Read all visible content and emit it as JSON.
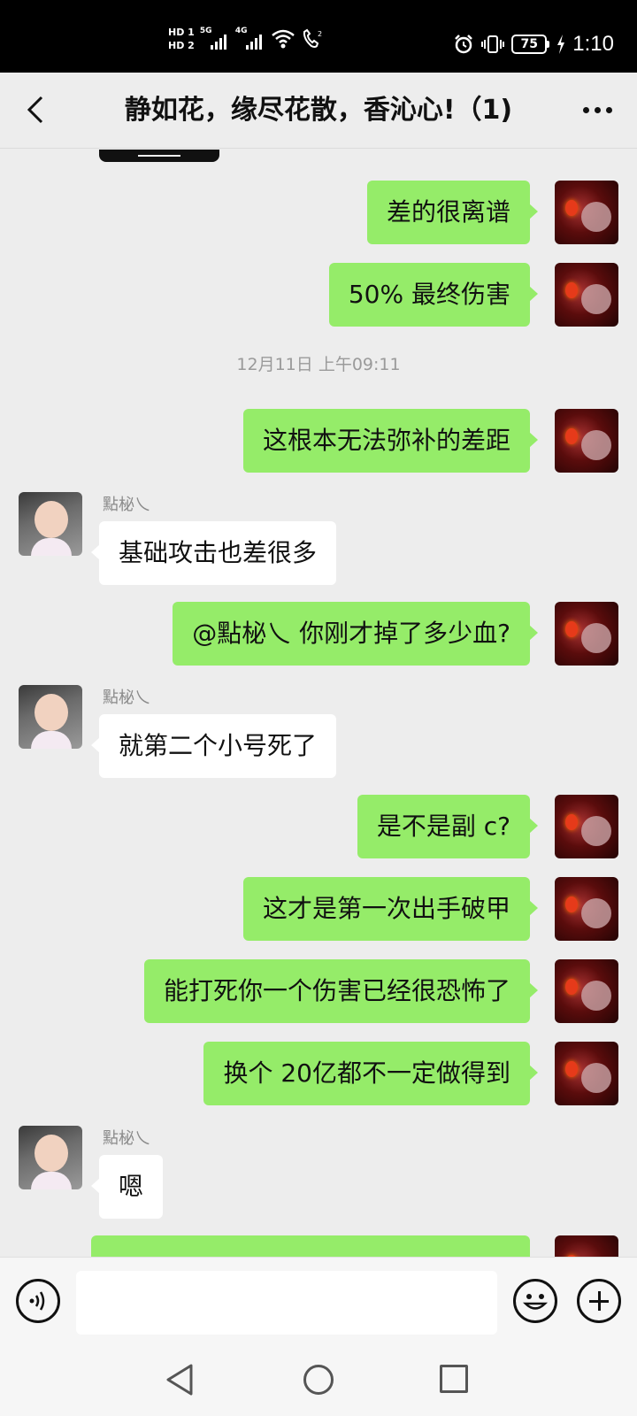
{
  "status_bar": {
    "sim1": "HD 1",
    "sim2": "HD 2",
    "net1": "5G",
    "net2": "4G",
    "battery": "75",
    "time": "1:10"
  },
  "nav": {
    "title": "静如花，缘尽花散，香沁心!（1)"
  },
  "messages": [
    {
      "side": "me",
      "text": "差的很离谱"
    },
    {
      "side": "me",
      "text": "50% 最终伤害"
    },
    {
      "type": "timestamp",
      "text": "12月11日 上午09:11"
    },
    {
      "side": "me",
      "text": "这根本无法弥补的差距"
    },
    {
      "side": "other",
      "sender": "點柲乀",
      "text": "基础攻击也差很多"
    },
    {
      "side": "me",
      "text": "@點柲乀  你刚才掉了多少血?"
    },
    {
      "side": "other",
      "sender": "點柲乀",
      "text": "就第二个小号死了"
    },
    {
      "side": "me",
      "text": "是不是副 c?"
    },
    {
      "side": "me",
      "text": "这才是第一次出手破甲"
    },
    {
      "side": "me",
      "text": "能打死你一个伤害已经很恐怖了"
    },
    {
      "side": "me",
      "text": "换个 20亿都不一定做得到"
    },
    {
      "side": "other",
      "sender": "點柲乀",
      "text": "嗯"
    }
  ],
  "input": {
    "value": ""
  },
  "icons": {
    "back": "back-arrow-icon",
    "more": "more-dots-icon",
    "voice": "voice-icon",
    "emoji": "emoji-icon",
    "plus": "plus-icon"
  },
  "colors": {
    "my_bubble": "#95ec69",
    "other_bubble": "#ffffff",
    "background": "#ededed"
  }
}
